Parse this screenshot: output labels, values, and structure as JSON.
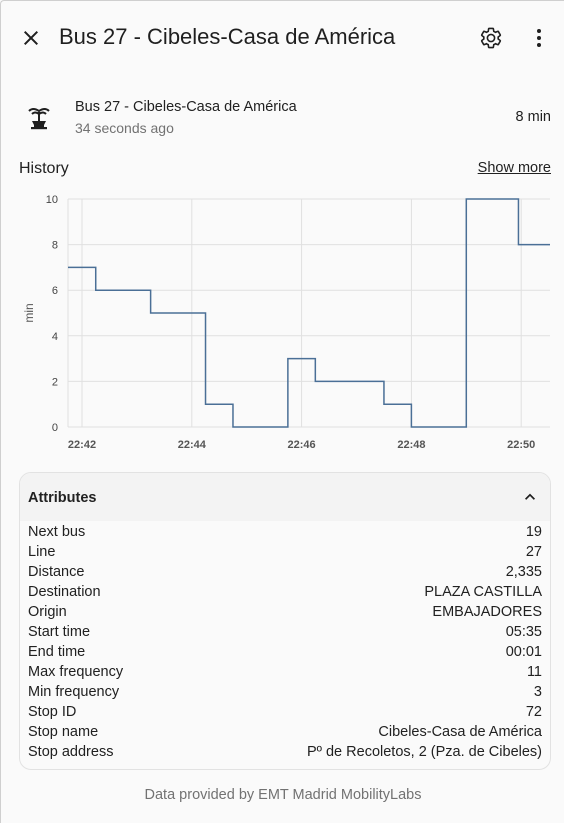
{
  "header": {
    "title": "Bus 27 - Cibeles-Casa de América",
    "close_icon": "close-icon",
    "settings_icon": "gear-icon",
    "more_icon": "more-vertical-icon"
  },
  "entity": {
    "icon": "fountain-icon",
    "name": "Bus 27 - Cibeles-Casa de América",
    "last_changed": "34 seconds ago",
    "state": "8 min"
  },
  "history": {
    "title": "History",
    "show_more": "Show more"
  },
  "chart_data": {
    "type": "line",
    "step": true,
    "title": "",
    "xlabel": "",
    "ylabel": "min",
    "ylim": [
      0,
      10
    ],
    "yticks": [
      "0",
      "2",
      "4",
      "6",
      "8",
      "10"
    ],
    "xticks": [
      "22:42",
      "22:44",
      "22:46",
      "22:48",
      "22:50"
    ],
    "grid": true,
    "color": "#4a6f96",
    "series": [
      {
        "x": [
          "22:41.7",
          "22:42.25",
          "22:43.25",
          "22:44.25",
          "22:44.75",
          "22:45.75",
          "22:46.25",
          "22:47.5",
          "22:48.0",
          "22:49.0",
          "22:49.95",
          "22:50.5"
        ],
        "values": [
          7,
          6,
          5,
          1,
          0,
          3,
          2,
          1,
          0,
          10,
          8,
          8
        ]
      }
    ]
  },
  "attributes": {
    "title": "Attributes",
    "chevron_icon": "chevron-up-icon",
    "rows": [
      {
        "label": "Next bus",
        "value": "19"
      },
      {
        "label": "Line",
        "value": "27"
      },
      {
        "label": "Distance",
        "value": "2,335"
      },
      {
        "label": "Destination",
        "value": "PLAZA CASTILLA"
      },
      {
        "label": "Origin",
        "value": "EMBAJADORES"
      },
      {
        "label": "Start time",
        "value": "05:35"
      },
      {
        "label": "End time",
        "value": "00:01"
      },
      {
        "label": "Max frequency",
        "value": "11"
      },
      {
        "label": "Min frequency",
        "value": "3"
      },
      {
        "label": "Stop ID",
        "value": "72"
      },
      {
        "label": "Stop name",
        "value": "Cibeles-Casa de América"
      },
      {
        "label": "Stop address",
        "value": "Pº de Recoletos, 2 (Pza. de Cibeles)"
      }
    ]
  },
  "footer": {
    "attribution": "Data provided by EMT Madrid MobilityLabs"
  }
}
